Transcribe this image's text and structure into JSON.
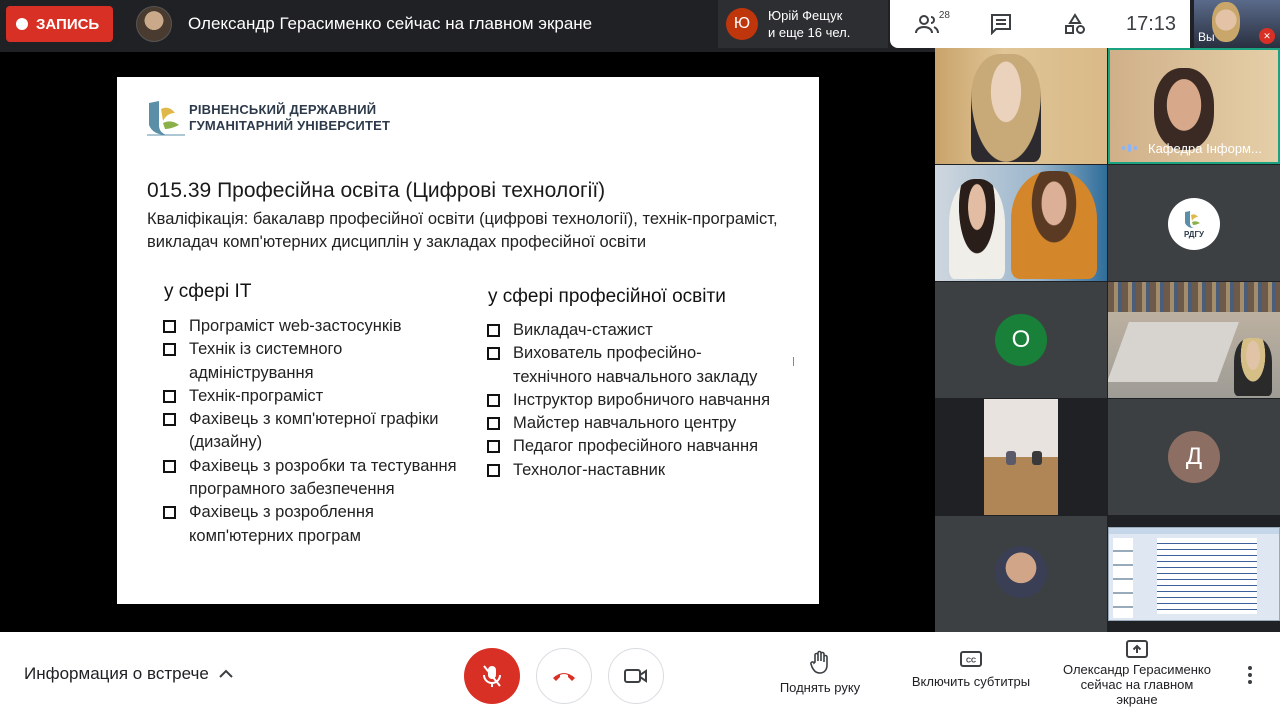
{
  "topbar": {
    "record_label": "ЗАПИСЬ",
    "presenter_text": "Олександр Герасименко сейчас на главном экране",
    "speaker_initial": "Ю",
    "speaker_name": "Юрій Фещук",
    "speaker_more": "и еще 16 чел.",
    "participants_count": "28",
    "clock": "17:13",
    "self_label": "Вы"
  },
  "slide": {
    "university_line1": "РІВНЕНСЬКИЙ ДЕРЖАВНИЙ",
    "university_line2": "ГУМАНІТАРНИЙ УНІВЕРСИТЕТ",
    "title": "015.39 Професійна освіта (Цифрові технології)",
    "qualification": "Кваліфікація: бакалавр професійної освіти (цифрові технології), технік-програміст, викладач комп'ютерних дисциплін у закладах професійної освіти",
    "left_heading": "у сфері IT",
    "left_items": [
      "Програміст web-застосунків",
      "Технік із системного адміністрування",
      "Технік-програміст",
      "Фахівець з комп'ютерної графіки (дизайну)",
      "Фахівець з розробки та тестування програмного забезпечення",
      "Фахівець з розроблення комп'ютерних програм"
    ],
    "right_heading": "у сфері професійної освіти",
    "right_items": [
      "Викладач-стажист",
      "Вихователь професійно-технічного навчального закладу",
      "Інструктор виробничого навчання",
      "Майстер навчального центру",
      "Педагог професійного навчання",
      "Технолог-наставник"
    ]
  },
  "grid": {
    "kafedra_label": "Кафедра Інформ...",
    "rdgu_text": "РДГУ",
    "o_initial": "О",
    "d_initial": "Д"
  },
  "bottom": {
    "meeting_info": "Информация о встрече",
    "raise_hand": "Поднять руку",
    "captions": "Включить субтитры",
    "presenting_line1": "Олександр Герасименко",
    "presenting_line2": "сейчас на главном",
    "presenting_line3": "экране"
  },
  "colors": {
    "record": "#d93025",
    "speaker_avatar": "#bf360c",
    "o_avatar": "#188038",
    "d_avatar": "#8d6e63",
    "active_speaker_border": "#1aa380"
  }
}
